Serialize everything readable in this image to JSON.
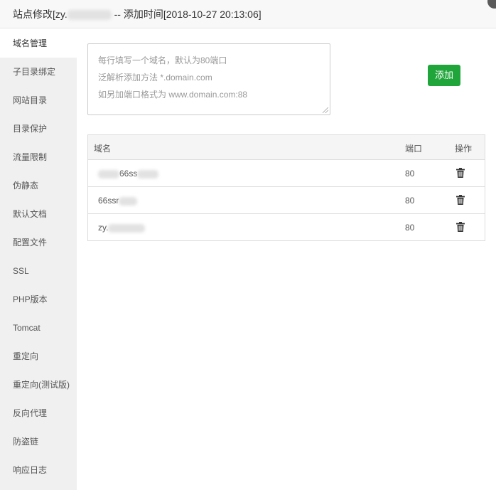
{
  "header": {
    "title_prefix": "站点修改[zy.",
    "title_suffix": " -- 添加时间[2018-10-27 20:13:06]"
  },
  "sidebar": {
    "items": [
      {
        "label": "域名管理",
        "active": true
      },
      {
        "label": "子目录绑定"
      },
      {
        "label": "网站目录"
      },
      {
        "label": "目录保护"
      },
      {
        "label": "流量限制"
      },
      {
        "label": "伪静态"
      },
      {
        "label": "默认文档"
      },
      {
        "label": "配置文件"
      },
      {
        "label": "SSL"
      },
      {
        "label": "PHP版本"
      },
      {
        "label": "Tomcat"
      },
      {
        "label": "重定向"
      },
      {
        "label": "重定向(测试版)"
      },
      {
        "label": "反向代理"
      },
      {
        "label": "防盗链"
      },
      {
        "label": "响应日志"
      }
    ]
  },
  "domain_input": {
    "placeholder_lines": [
      "每行填写一个域名，默认为80端口",
      "泛解析添加方法 *.domain.com",
      "如另加端口格式为 www.domain.com:88"
    ],
    "value": ""
  },
  "add_button": {
    "label": "添加"
  },
  "table": {
    "headers": {
      "domain": "域名",
      "port": "端口",
      "actions": "操作"
    },
    "rows": [
      {
        "domain": "66ss",
        "port": "80"
      },
      {
        "domain": "66ssr",
        "port": "80"
      },
      {
        "domain": "zy.",
        "port": "80"
      }
    ]
  },
  "icons": {
    "delete": "trash-icon",
    "close": "close-icon"
  },
  "colors": {
    "accent": "#20a53a",
    "sidebar_bg": "#f0f0f0",
    "header_bg": "#f8f8f8"
  }
}
